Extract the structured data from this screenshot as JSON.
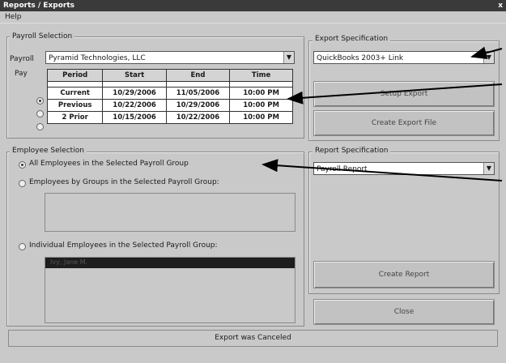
{
  "window": {
    "title": "Reports / Exports",
    "close": "x"
  },
  "menu": {
    "help": "Help"
  },
  "payroll": {
    "group_label": "Payroll Selection",
    "payroll_label": "Payroll",
    "payroll_value": "Pyramid Technologies, LLC",
    "pay_label": "Pay",
    "columns": [
      "Period",
      "Start",
      "End",
      "Time"
    ],
    "rows": [
      {
        "period": "Current",
        "start": "10/29/2006",
        "end": "11/05/2006",
        "time": "10:00 PM",
        "selected": true
      },
      {
        "period": "Previous",
        "start": "10/22/2006",
        "end": "10/29/2006",
        "time": "10:00 PM",
        "selected": false
      },
      {
        "period": "2 Prior",
        "start": "10/15/2006",
        "end": "10/22/2006",
        "time": "10:00 PM",
        "selected": false
      }
    ]
  },
  "employee": {
    "group_label": "Employee Selection",
    "opt_all": "All Employees in the Selected Payroll Group",
    "opt_groups": "Employees by Groups in the Selected Payroll Group:",
    "opt_individual": "Individual Employees in the Selected Payroll Group:",
    "list_item": "Ivy, Jane M."
  },
  "export": {
    "group_label": "Export Specification",
    "value": "QuickBooks 2003+ Link",
    "setup_button": "Setup Export",
    "create_button": "Create Export File"
  },
  "report": {
    "group_label": "Report Specification",
    "value": "Payroll Report",
    "create_button": "Create Report"
  },
  "close_button": "Close",
  "status": "Export was Canceled"
}
